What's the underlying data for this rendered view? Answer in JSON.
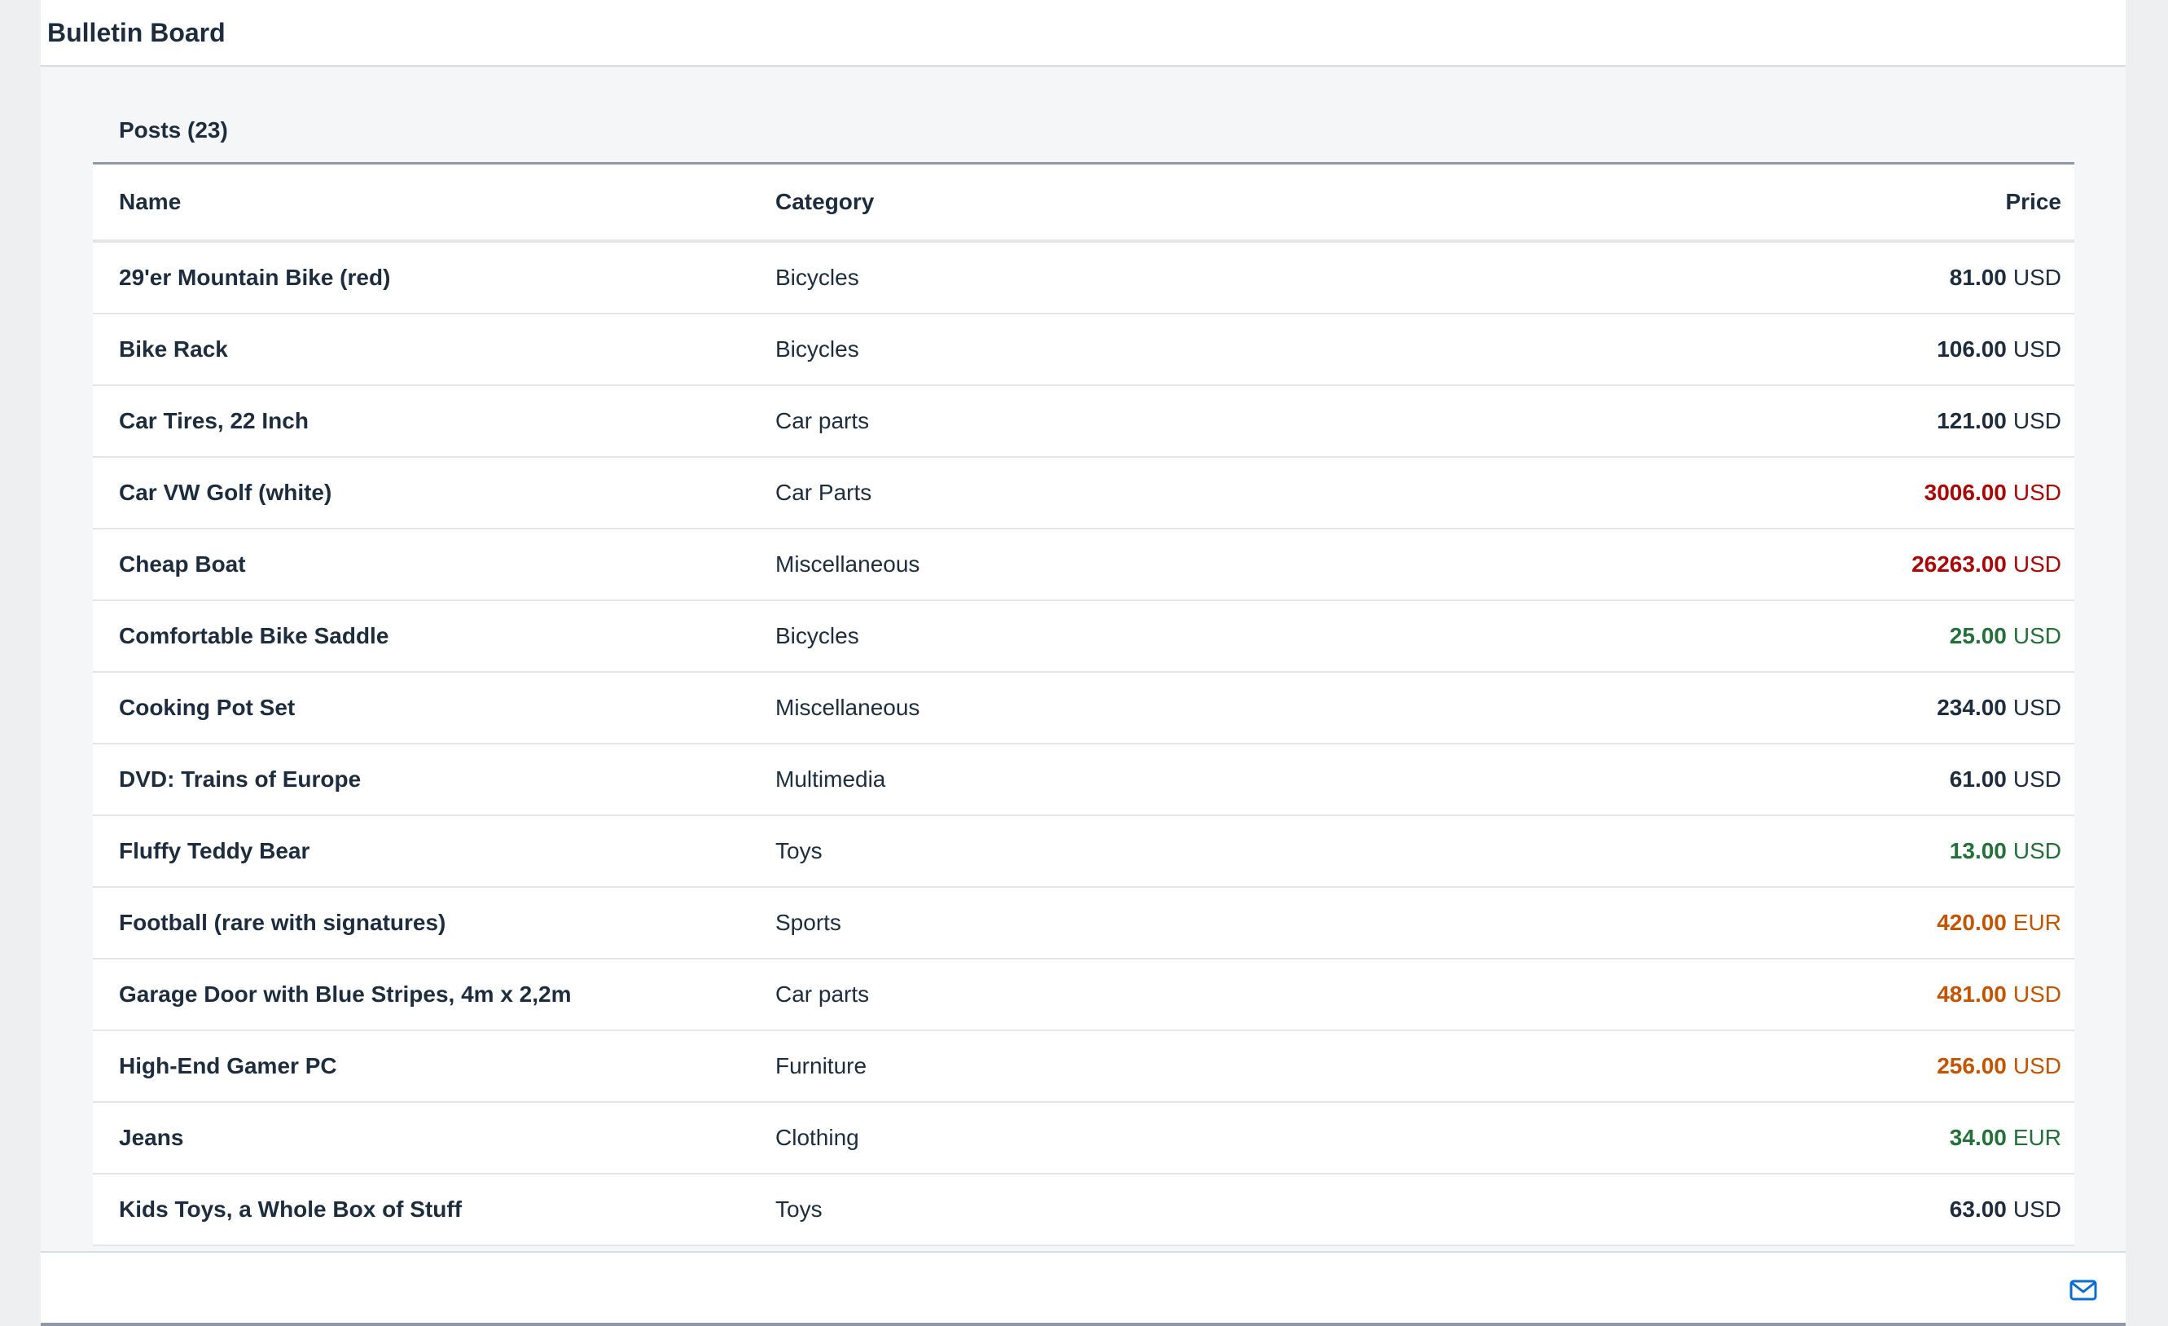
{
  "header": {
    "title": "Bulletin Board"
  },
  "toolbar": {
    "title": "Posts (23)"
  },
  "table": {
    "columns": {
      "name": "Name",
      "category": "Category",
      "price": "Price"
    },
    "rows": [
      {
        "name": "29'er Mountain Bike (red)",
        "category": "Bicycles",
        "price": "81.00",
        "currency": "USD",
        "state": "none"
      },
      {
        "name": "Bike Rack",
        "category": "Bicycles",
        "price": "106.00",
        "currency": "USD",
        "state": "none"
      },
      {
        "name": "Car Tires, 22 Inch",
        "category": "Car parts",
        "price": "121.00",
        "currency": "USD",
        "state": "none"
      },
      {
        "name": "Car VW Golf (white)",
        "category": "Car Parts",
        "price": "3006.00",
        "currency": "USD",
        "state": "error"
      },
      {
        "name": "Cheap Boat",
        "category": "Miscellaneous",
        "price": "26263.00",
        "currency": "USD",
        "state": "error"
      },
      {
        "name": "Comfortable Bike Saddle",
        "category": "Bicycles",
        "price": "25.00",
        "currency": "USD",
        "state": "success"
      },
      {
        "name": "Cooking Pot Set",
        "category": "Miscellaneous",
        "price": "234.00",
        "currency": "USD",
        "state": "none"
      },
      {
        "name": "DVD: Trains of Europe",
        "category": "Multimedia",
        "price": "61.00",
        "currency": "USD",
        "state": "none"
      },
      {
        "name": "Fluffy Teddy Bear",
        "category": "Toys",
        "price": "13.00",
        "currency": "USD",
        "state": "success"
      },
      {
        "name": "Football (rare with signatures)",
        "category": "Sports",
        "price": "420.00",
        "currency": "EUR",
        "state": "warning"
      },
      {
        "name": "Garage Door with Blue Stripes, 4m x 2,2m",
        "category": "Car parts",
        "price": "481.00",
        "currency": "USD",
        "state": "warning"
      },
      {
        "name": "High-End Gamer PC",
        "category": "Furniture",
        "price": "256.00",
        "currency": "USD",
        "state": "warning"
      },
      {
        "name": "Jeans",
        "category": "Clothing",
        "price": "34.00",
        "currency": "EUR",
        "state": "success"
      },
      {
        "name": "Kids Toys, a Whole Box of Stuff",
        "category": "Toys",
        "price": "63.00",
        "currency": "USD",
        "state": "none"
      }
    ]
  },
  "footer": {
    "mail_icon": "mail-icon"
  },
  "colors": {
    "text": "#1d2d3e",
    "error": "#aa0808",
    "success": "#256f3a",
    "warning": "#c35500",
    "accent": "#0a6ed1"
  }
}
